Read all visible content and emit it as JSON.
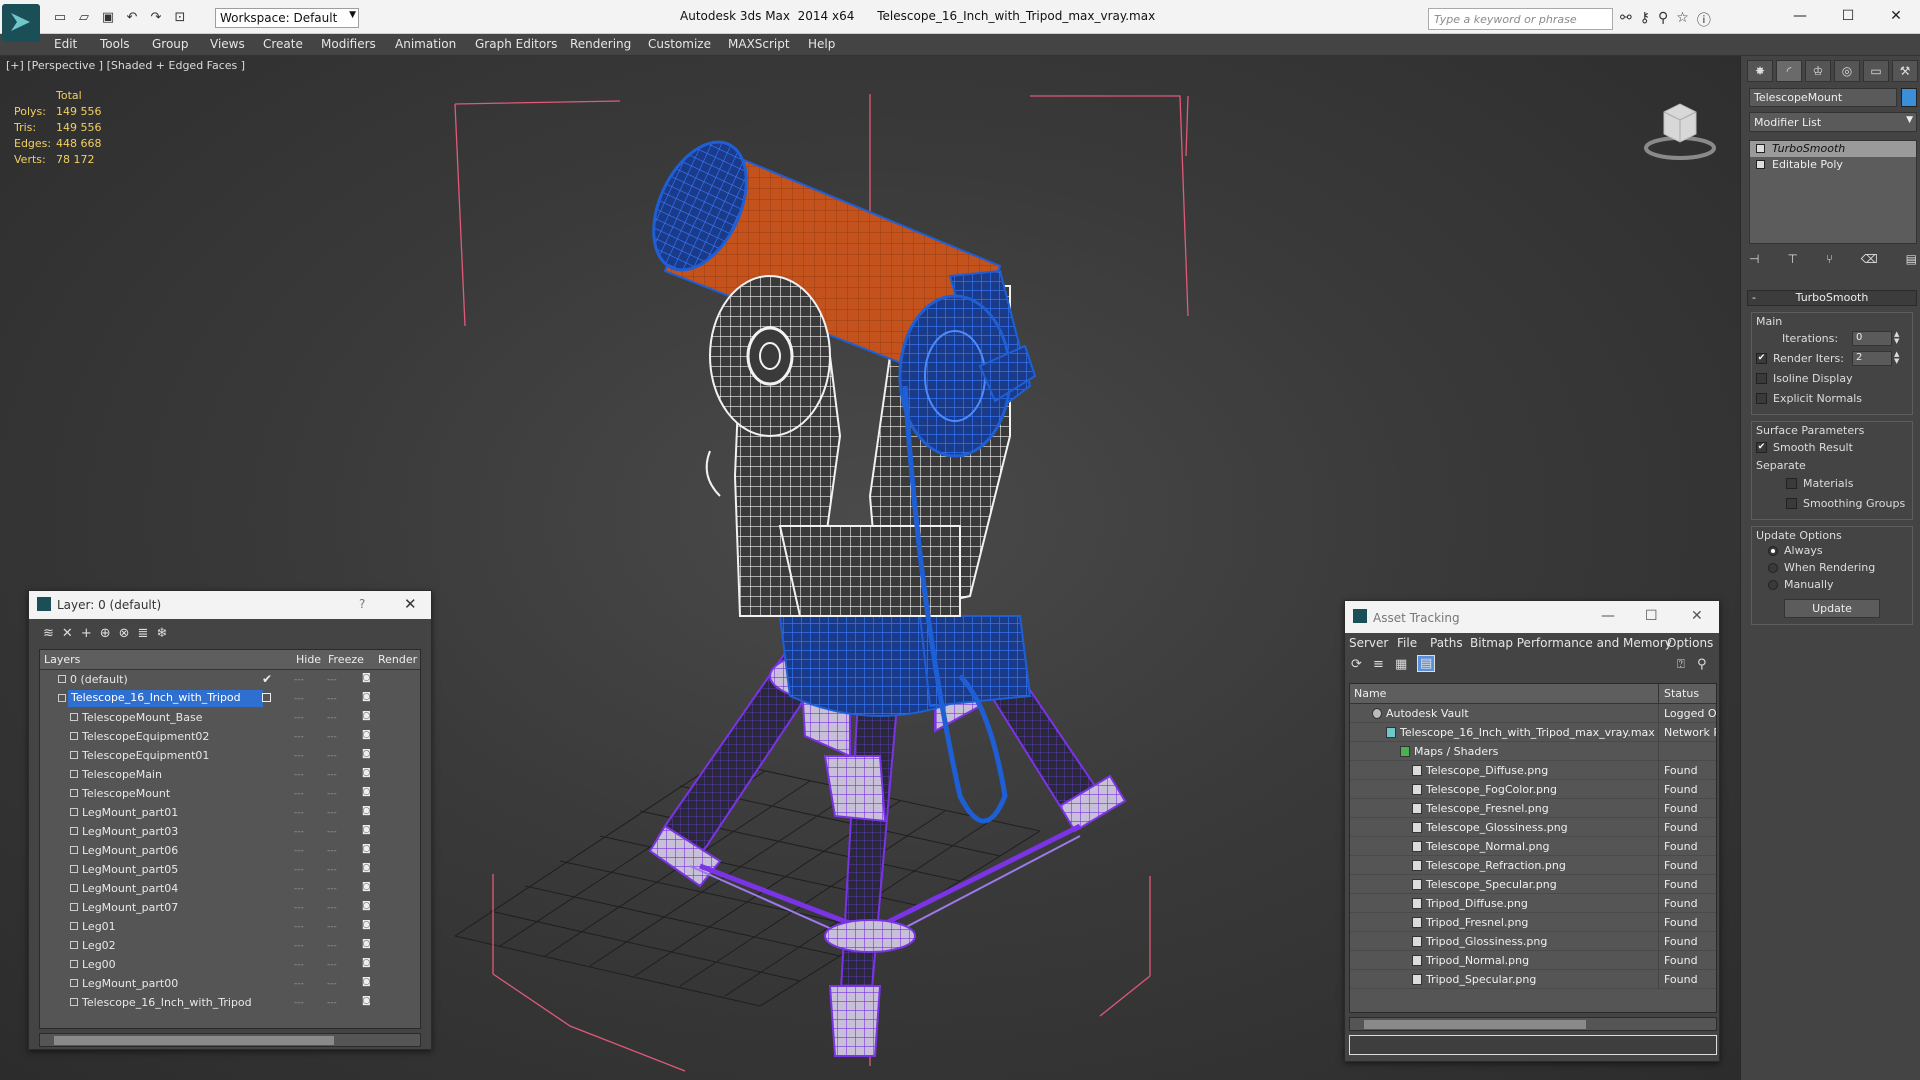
{
  "titlebar": {
    "app_title": "Autodesk 3ds Max  2014 x64",
    "file_title": "Telescope_16_Inch_with_Tripod_max_vray.max",
    "workspace": "Workspace: Default",
    "search_placeholder": "Type a keyword or phrase",
    "minimize": "—",
    "maximize": "☐",
    "close": "✕"
  },
  "menu": [
    "Edit",
    "Tools",
    "Group",
    "Views",
    "Create",
    "Modifiers",
    "Animation",
    "Graph Editors",
    "Rendering",
    "Customize",
    "MAXScript",
    "Help"
  ],
  "viewport": {
    "label": "[+] [Perspective ] [Shaded + Edged Faces ]",
    "stats": {
      "header": "Total",
      "polys_label": "Polys:",
      "polys": "149 556",
      "tris_label": "Tris:",
      "tris": "149 556",
      "edges_label": "Edges:",
      "edges": "448 668",
      "verts_label": "Verts:",
      "verts": "78 172"
    },
    "colors": {
      "tube": "#c4521c",
      "wire_blue": "#1f5fd6",
      "wire_purple": "#7b33e6",
      "wire_white": "#f2f2f2",
      "bbox": "#e05a7a"
    }
  },
  "command_panel": {
    "object_name": "TelescopeMount",
    "object_color": "#3b8fd9",
    "modifier_list": "Modifier List",
    "stack": [
      "TurboSmooth",
      "Editable Poly"
    ],
    "rollout_title": "TurboSmooth",
    "main_group": "Main",
    "iterations_label": "Iterations:",
    "iterations": "0",
    "render_iters_label": "Render Iters:",
    "render_iters": "2",
    "isoline": "Isoline Display",
    "explicit_normals": "Explicit Normals",
    "surface_group": "Surface Parameters",
    "smooth_result": "Smooth Result",
    "separate": "Separate",
    "materials": "Materials",
    "smoothing_groups": "Smoothing Groups",
    "update_group": "Update Options",
    "always": "Always",
    "when_rendering": "When Rendering",
    "manually": "Manually",
    "update_button": "Update"
  },
  "layer_window": {
    "title": "Layer: 0 (default)",
    "help": "?",
    "close": "✕",
    "headers": {
      "layers": "Layers",
      "hide": "Hide",
      "freeze": "Freeze",
      "render": "Render"
    },
    "rows": [
      {
        "name": "0 (default)",
        "indent": 1,
        "active": true
      },
      {
        "name": "Telescope_16_Inch_with_Tripod",
        "indent": 0,
        "selected": true
      },
      {
        "name": "TelescopeMount_Base",
        "indent": 2
      },
      {
        "name": "TelescopeEquipment02",
        "indent": 2
      },
      {
        "name": "TelescopeEquipment01",
        "indent": 2
      },
      {
        "name": "TelescopeMain",
        "indent": 2
      },
      {
        "name": "TelescopeMount",
        "indent": 2
      },
      {
        "name": "LegMount_part01",
        "indent": 2
      },
      {
        "name": "LegMount_part03",
        "indent": 2
      },
      {
        "name": "LegMount_part06",
        "indent": 2
      },
      {
        "name": "LegMount_part05",
        "indent": 2
      },
      {
        "name": "LegMount_part04",
        "indent": 2
      },
      {
        "name": "LegMount_part07",
        "indent": 2
      },
      {
        "name": "Leg01",
        "indent": 2
      },
      {
        "name": "Leg02",
        "indent": 2
      },
      {
        "name": "Leg00",
        "indent": 2
      },
      {
        "name": "LegMount_part00",
        "indent": 2
      },
      {
        "name": "Telescope_16_Inch_with_Tripod",
        "indent": 2
      }
    ]
  },
  "asset_window": {
    "title": "Asset Tracking",
    "menu": [
      "Server",
      "File",
      "Paths",
      "Bitmap Performance and Memory",
      "Options"
    ],
    "headers": {
      "name": "Name",
      "status": "Status"
    },
    "rows": [
      {
        "name": "Autodesk Vault",
        "status": "Logged Out",
        "level": 0
      },
      {
        "name": "Telescope_16_Inch_with_Tripod_max_vray.max",
        "status": "Network Path",
        "level": 1
      },
      {
        "name": "Maps / Shaders",
        "status": "",
        "level": 2
      },
      {
        "name": "Telescope_Diffuse.png",
        "status": "Found",
        "level": 3
      },
      {
        "name": "Telescope_FogColor.png",
        "status": "Found",
        "level": 3
      },
      {
        "name": "Telescope_Fresnel.png",
        "status": "Found",
        "level": 3
      },
      {
        "name": "Telescope_Glossiness.png",
        "status": "Found",
        "level": 3
      },
      {
        "name": "Telescope_Normal.png",
        "status": "Found",
        "level": 3
      },
      {
        "name": "Telescope_Refraction.png",
        "status": "Found",
        "level": 3
      },
      {
        "name": "Telescope_Specular.png",
        "status": "Found",
        "level": 3
      },
      {
        "name": "Tripod_Diffuse.png",
        "status": "Found",
        "level": 3
      },
      {
        "name": "Tripod_Fresnel.png",
        "status": "Found",
        "level": 3
      },
      {
        "name": "Tripod_Glossiness.png",
        "status": "Found",
        "level": 3
      },
      {
        "name": "Tripod_Normal.png",
        "status": "Found",
        "level": 3
      },
      {
        "name": "Tripod_Specular.png",
        "status": "Found",
        "level": 3
      }
    ]
  }
}
